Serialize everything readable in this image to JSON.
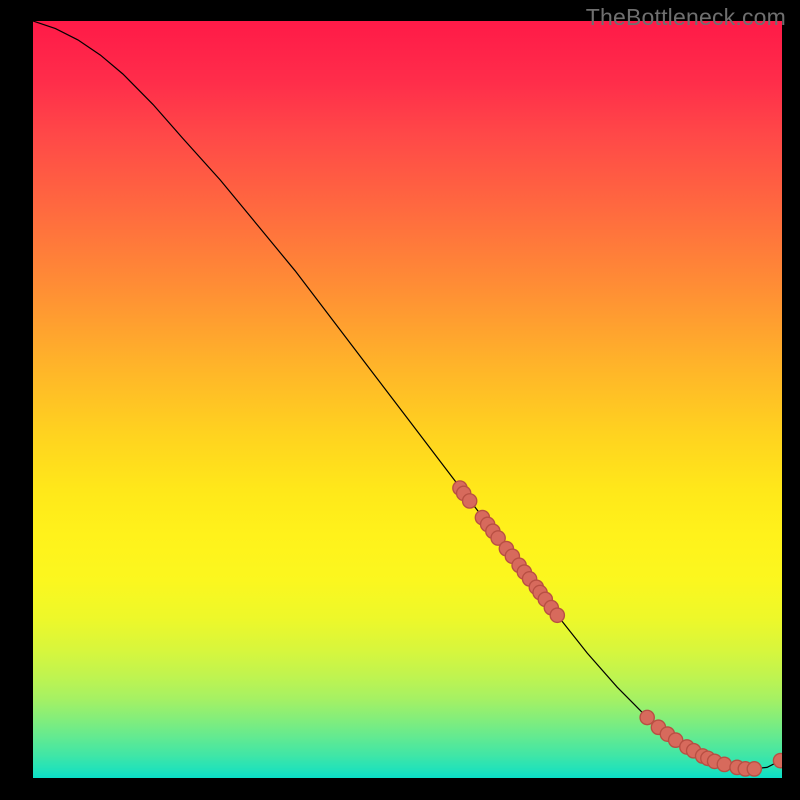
{
  "watermark": "TheBottleneck.com",
  "chart_data": {
    "type": "line",
    "title": "",
    "xlabel": "",
    "ylabel": "",
    "xlim": [
      0,
      100
    ],
    "ylim": [
      0,
      100
    ],
    "series": [
      {
        "name": "curve",
        "x": [
          0,
          3,
          6,
          9,
          12,
          16,
          20,
          25,
          30,
          35,
          40,
          45,
          50,
          55,
          60,
          65,
          70,
          74,
          78,
          82,
          85,
          88,
          90,
          92,
          94,
          96,
          98,
          100
        ],
        "y": [
          100,
          99,
          97.5,
          95.5,
          93,
          89,
          84.5,
          79,
          73,
          67,
          60.5,
          54,
          47.5,
          41,
          34.5,
          28,
          21.5,
          16.5,
          12,
          8,
          5.5,
          3.7,
          2.6,
          1.9,
          1.4,
          1.2,
          1.4,
          2.4
        ]
      }
    ],
    "dots": [
      {
        "x": 57.0,
        "y": 38.3
      },
      {
        "x": 57.5,
        "y": 37.6
      },
      {
        "x": 58.3,
        "y": 36.6
      },
      {
        "x": 60.0,
        "y": 34.4
      },
      {
        "x": 60.7,
        "y": 33.5
      },
      {
        "x": 61.4,
        "y": 32.6
      },
      {
        "x": 62.1,
        "y": 31.7
      },
      {
        "x": 63.2,
        "y": 30.3
      },
      {
        "x": 64.0,
        "y": 29.3
      },
      {
        "x": 64.9,
        "y": 28.1
      },
      {
        "x": 65.6,
        "y": 27.2
      },
      {
        "x": 66.3,
        "y": 26.3
      },
      {
        "x": 67.2,
        "y": 25.2
      },
      {
        "x": 67.7,
        "y": 24.5
      },
      {
        "x": 68.4,
        "y": 23.6
      },
      {
        "x": 69.2,
        "y": 22.5
      },
      {
        "x": 70.0,
        "y": 21.5
      },
      {
        "x": 82.0,
        "y": 8.0
      },
      {
        "x": 83.5,
        "y": 6.7
      },
      {
        "x": 84.7,
        "y": 5.8
      },
      {
        "x": 85.8,
        "y": 5.0
      },
      {
        "x": 87.3,
        "y": 4.1
      },
      {
        "x": 88.2,
        "y": 3.6
      },
      {
        "x": 89.4,
        "y": 2.9
      },
      {
        "x": 90.1,
        "y": 2.6
      },
      {
        "x": 91.0,
        "y": 2.2
      },
      {
        "x": 92.3,
        "y": 1.8
      },
      {
        "x": 94.0,
        "y": 1.4
      },
      {
        "x": 95.1,
        "y": 1.2
      },
      {
        "x": 96.3,
        "y": 1.2
      },
      {
        "x": 99.8,
        "y": 2.3
      }
    ],
    "colors": {
      "curve": "#000000",
      "dot_fill": "#d76a5c",
      "dot_stroke": "#b84f43"
    }
  }
}
